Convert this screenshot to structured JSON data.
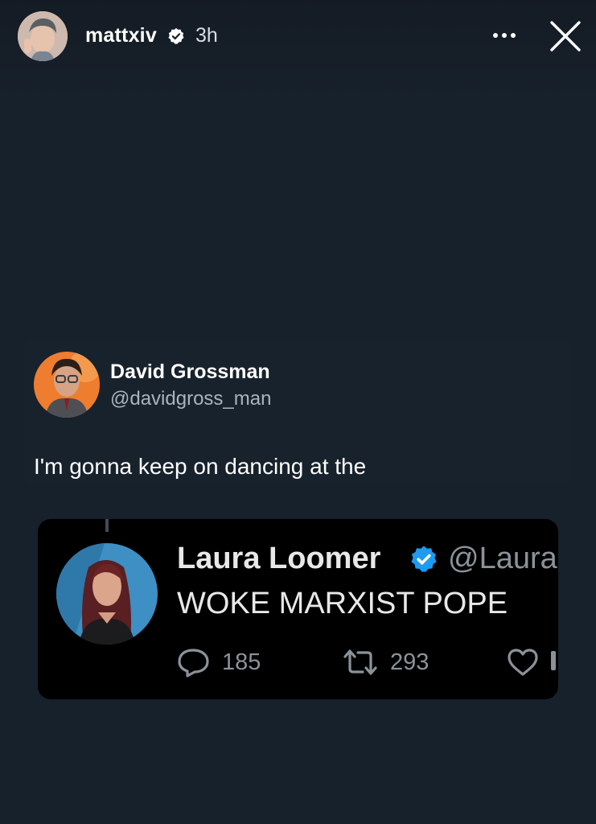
{
  "story": {
    "username": "mattxiv",
    "time": "3h",
    "verified_icon": "verified-badge-icon",
    "more_icon": "more-options-icon",
    "close_icon": "close-icon"
  },
  "tweet": {
    "display_name": "David Grossman",
    "handle": "@davidgross_man",
    "text": "I'm gonna keep on dancing at the"
  },
  "quoted_tweet": {
    "display_name": "Laura Loomer",
    "handle": "@Laura",
    "text": "WOKE MARXIST POPE",
    "replies": "185",
    "retweets": "293",
    "verified_color": "#1d9bf0"
  },
  "colors": {
    "background": "#17212b",
    "quote_background": "#000000",
    "verified_blue": "#1d9bf0",
    "muted_text": "#8b9299"
  }
}
